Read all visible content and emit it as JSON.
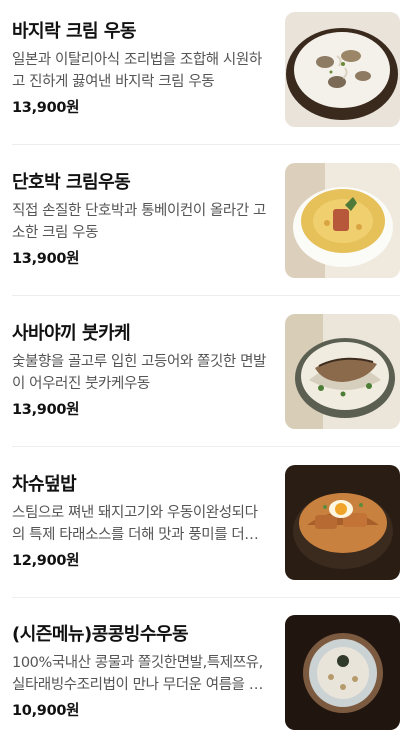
{
  "menu": [
    {
      "title": "바지락 크림 우동",
      "desc": "일본과 이탈리아식 조리법을 조합해 시원하고 진하게 끓여낸 바지락 크림 우동",
      "price": "13,900원"
    },
    {
      "title": "단호박 크림우동",
      "desc": "직접 손질한 단호박과 통베이컨이 올라간 고소한 크림 우동",
      "price": "13,900원"
    },
    {
      "title": "사바야끼 붓카케",
      "desc": "숯불향을 골고루 입힌 고등어와 쫄깃한 면발이 어우러진 붓카케우동",
      "price": "13,900원"
    },
    {
      "title": "차슈덮밥",
      "desc": "스팀으로 쪄낸 돼지고기와 우동이완성되다의 특제 타래소스를 더해 맛과 풍미를 더한 덮밥",
      "price": "12,900원"
    },
    {
      "title": "(시즌메뉴)콩콩빙수우동",
      "desc": "100%국내산 콩물과 쫄깃한면발,특제쯔유,실타래빙수조리법이 만나 무더운 여름을 시원하게",
      "price": "10,900원"
    }
  ]
}
